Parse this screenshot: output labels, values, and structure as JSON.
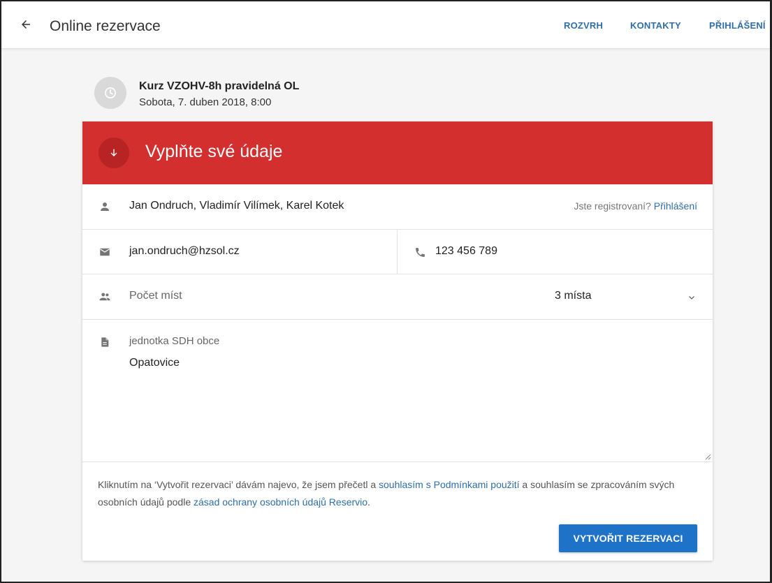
{
  "header": {
    "title": "Online rezervace",
    "nav": [
      "ROZVRH",
      "KONTAKTY",
      "PŘIHLÁŠENÍ"
    ]
  },
  "event": {
    "title": "Kurz VZOHV-8h pravidelná OL",
    "date": "Sobota, 7. duben 2018, 8:00"
  },
  "form": {
    "banner_title": "Vyplňte své údaje",
    "name_value": "Jan Ondruch, Vladimír Vilímek, Karel Kotek",
    "registered_hint": "Jste registrovaní?",
    "login_link": "Přihlášení",
    "email_value": "jan.ondruch@hzsol.cz",
    "phone_value": "123 456 789",
    "seats_label": "Počet míst",
    "seats_value": "3 místa",
    "note_label": "jednotka SDH obce",
    "note_value": "Opatovice",
    "consent_part1": "Kliknutím na ‘Vytvořit rezervaci’ dávám najevo, že jsem přečetl a ",
    "consent_link1": "souhlasím s Podmínkami použití",
    "consent_part2": " a souhlasím se zpracováním svých osobních údajů podle ",
    "consent_link2": "zásad ochrany osobních údajů Reservio",
    "consent_part3": ".",
    "submit_label": "VYTVOŘIT REZERVACI"
  },
  "colors": {
    "banner": "#d32f2f",
    "accent": "#2f6ea8",
    "button": "#1e73c8"
  },
  "icons": [
    "back-arrow-icon",
    "clock-icon",
    "arrow-down-icon",
    "person-icon",
    "mail-icon",
    "phone-icon",
    "people-icon",
    "chevron-down-icon",
    "document-icon",
    "resize-grip-icon"
  ]
}
